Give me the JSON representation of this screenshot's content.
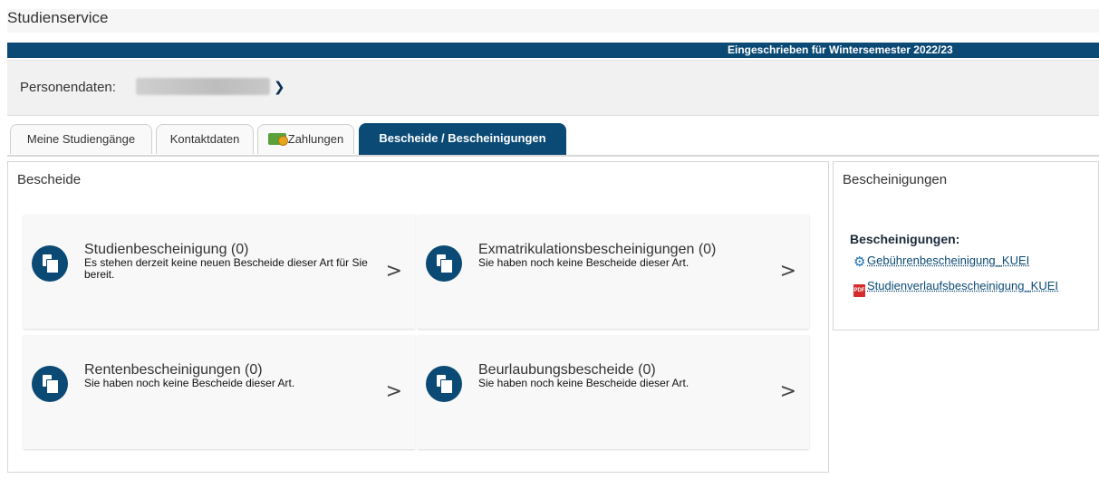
{
  "header": {
    "title": "Studienservice",
    "enrollment_status": "Eingeschrieben für Wintersemester 2022/23"
  },
  "person": {
    "label": "Personendaten:"
  },
  "tabs": [
    {
      "label": "Meine Studiengänge",
      "active": false
    },
    {
      "label": "Kontaktdaten",
      "active": false
    },
    {
      "label": "Zahlungen",
      "active": false,
      "icon": "money-icon"
    },
    {
      "label": "Bescheide / Bescheinigungen",
      "active": true
    }
  ],
  "bescheide": {
    "title": "Bescheide",
    "cards": [
      {
        "title": "Studienbescheinigung (0)",
        "desc": "Es stehen derzeit keine neuen Bescheide dieser Art für Sie bereit.",
        "chevron": ">"
      },
      {
        "title": "Exmatrikulationsbescheinigungen (0)",
        "desc": "Sie haben noch keine Bescheide dieser Art.",
        "chevron": ">"
      },
      {
        "title": "Rentenbescheinigungen (0)",
        "desc": "Sie haben noch keine Bescheide dieser Art.",
        "chevron": ">"
      },
      {
        "title": "Beurlaubungsbescheide (0)",
        "desc": "Sie haben noch keine Bescheide dieser Art.",
        "chevron": ">"
      }
    ]
  },
  "bescheinigungen": {
    "title": "Bescheinigungen",
    "heading": "Bescheinigungen:",
    "links": [
      {
        "label": "Gebührenbescheinigung_KUEI",
        "icon": "gear-icon"
      },
      {
        "label": "Studienverlaufsbescheinigung_KUEI",
        "icon": "pdf-icon"
      }
    ]
  },
  "colors": {
    "primary": "#0b4a75",
    "page_bg": "#ffffff",
    "card_bg": "#f8f8f8"
  }
}
